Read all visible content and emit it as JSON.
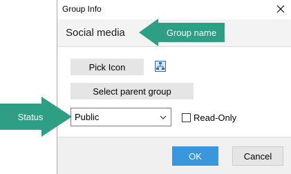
{
  "dialog": {
    "title": "Group Info",
    "group_name": "Social media"
  },
  "buttons": {
    "pick_icon": "Pick Icon",
    "select_parent": "Select parent group",
    "ok": "OK",
    "cancel": "Cancel"
  },
  "status": {
    "selected": "Public"
  },
  "readonly": {
    "label": "Read-Only",
    "checked": false
  },
  "callouts": {
    "group_name": "Group name",
    "status": "Status",
    "color": "#2e9e84"
  },
  "icons": {
    "close": "close-icon",
    "pick_icon_preview": "network-icon",
    "dropdown": "chevron-down-icon"
  },
  "colors": {
    "accent": "#3a96dd",
    "callout": "#2e9e84"
  }
}
